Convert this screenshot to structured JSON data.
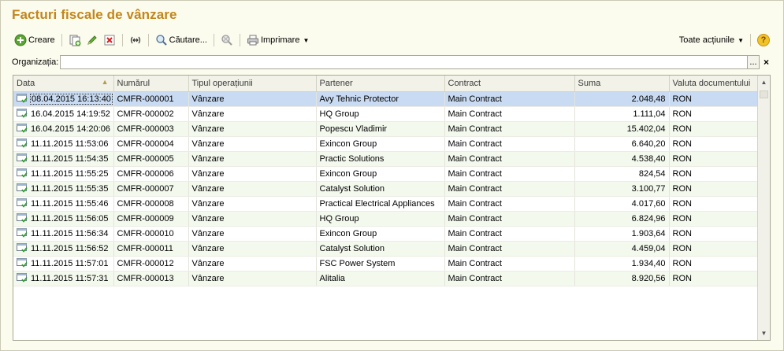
{
  "window": {
    "title": "Facturi fiscale de vânzare"
  },
  "toolbar": {
    "create_label": "Creare",
    "search_label": "Căutare...",
    "print_label": "Imprimare",
    "all_actions_label": "Toate acțiunile"
  },
  "filter": {
    "label": "Organizația:",
    "value": "",
    "select_label": "...",
    "clear_label": "×"
  },
  "table": {
    "columns": [
      "Data",
      "Numărul",
      "Tipul operațiunii",
      "Partener",
      "Contract",
      "Suma",
      "Valuta documentului"
    ],
    "rows": [
      {
        "date": "08.04.2015 16:13:40",
        "number": "CMFR-000001",
        "type": "Vânzare",
        "partner": "Avy Tehnic Protector",
        "contract": "Main Contract",
        "sum": "2.048,48",
        "currency": "RON"
      },
      {
        "date": "16.04.2015 14:19:52",
        "number": "CMFR-000002",
        "type": "Vânzare",
        "partner": "HQ Group",
        "contract": "Main Contract",
        "sum": "1.111,04",
        "currency": "RON"
      },
      {
        "date": "16.04.2015 14:20:06",
        "number": "CMFR-000003",
        "type": "Vânzare",
        "partner": "Popescu Vladimir",
        "contract": "Main Contract",
        "sum": "15.402,04",
        "currency": "RON"
      },
      {
        "date": "11.11.2015 11:53:06",
        "number": "CMFR-000004",
        "type": "Vânzare",
        "partner": "Exincon Group",
        "contract": "Main Contract",
        "sum": "6.640,20",
        "currency": "RON"
      },
      {
        "date": "11.11.2015 11:54:35",
        "number": "CMFR-000005",
        "type": "Vânzare",
        "partner": "Practic Solutions",
        "contract": "Main Contract",
        "sum": "4.538,40",
        "currency": "RON"
      },
      {
        "date": "11.11.2015 11:55:25",
        "number": "CMFR-000006",
        "type": "Vânzare",
        "partner": "Exincon Group",
        "contract": "Main Contract",
        "sum": "824,54",
        "currency": "RON"
      },
      {
        "date": "11.11.2015 11:55:35",
        "number": "CMFR-000007",
        "type": "Vânzare",
        "partner": "Catalyst Solution",
        "contract": "Main Contract",
        "sum": "3.100,77",
        "currency": "RON"
      },
      {
        "date": "11.11.2015 11:55:46",
        "number": "CMFR-000008",
        "type": "Vânzare",
        "partner": "Practical Electrical Appliances",
        "contract": "Main Contract",
        "sum": "4.017,60",
        "currency": "RON"
      },
      {
        "date": "11.11.2015 11:56:05",
        "number": "CMFR-000009",
        "type": "Vânzare",
        "partner": "HQ Group",
        "contract": "Main Contract",
        "sum": "6.824,96",
        "currency": "RON"
      },
      {
        "date": "11.11.2015 11:56:34",
        "number": "CMFR-000010",
        "type": "Vânzare",
        "partner": "Exincon Group",
        "contract": "Main Contract",
        "sum": "1.903,64",
        "currency": "RON"
      },
      {
        "date": "11.11.2015 11:56:52",
        "number": "CMFR-000011",
        "type": "Vânzare",
        "partner": "Catalyst Solution",
        "contract": "Main Contract",
        "sum": "4.459,04",
        "currency": "RON"
      },
      {
        "date": "11.11.2015 11:57:01",
        "number": "CMFR-000012",
        "type": "Vânzare",
        "partner": "FSC Power System",
        "contract": "Main Contract",
        "sum": "1.934,40",
        "currency": "RON"
      },
      {
        "date": "11.11.2015 11:57:31",
        "number": "CMFR-000013",
        "type": "Vânzare",
        "partner": "Alitalia",
        "contract": "Main Contract",
        "sum": "8.920,56",
        "currency": "RON"
      }
    ]
  },
  "icons": [
    "create-icon",
    "copy-icon",
    "edit-icon",
    "delete-icon",
    "link-icon",
    "search-icon",
    "clear-search-icon",
    "print-icon",
    "help-icon",
    "document-posted-icon"
  ],
  "colors": {
    "title": "#c2861a",
    "selected_row": "#c9dbf2",
    "alt_row": "#f4f9ee"
  }
}
